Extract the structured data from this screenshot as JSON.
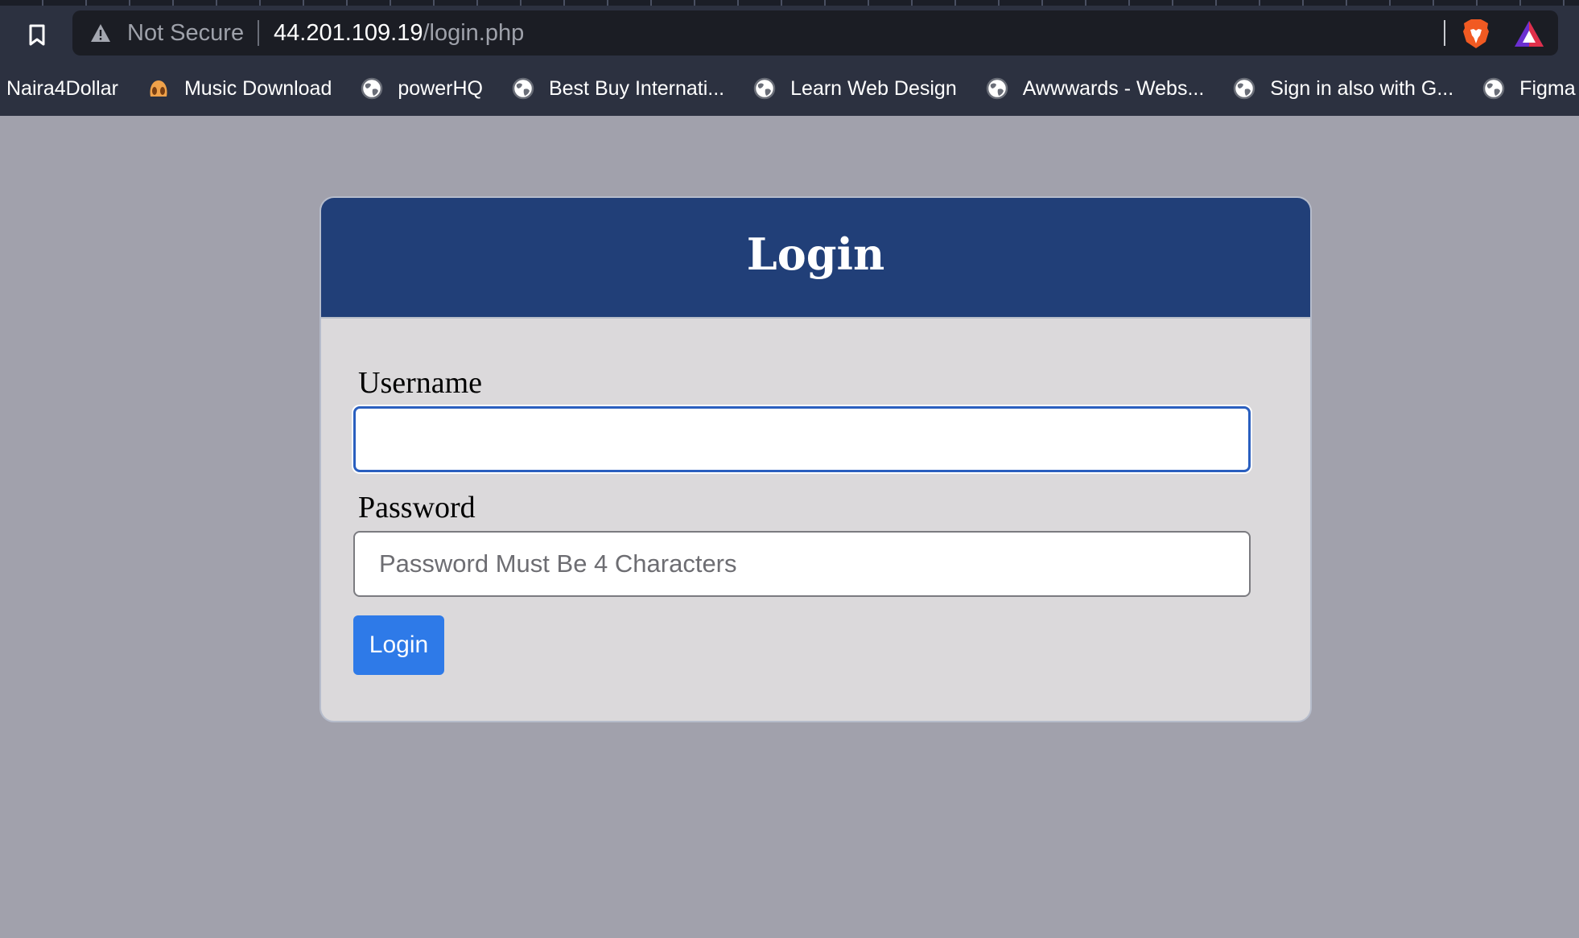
{
  "browser": {
    "security_label": "Not Secure",
    "url_host": "44.201.109.19",
    "url_path": "/login.php",
    "bookmarks": [
      {
        "label": "Naira4Dollar",
        "icon": "none"
      },
      {
        "label": "Music Download",
        "icon": "app-icon"
      },
      {
        "label": "powerHQ",
        "icon": "globe-icon"
      },
      {
        "label": "Best Buy Internati...",
        "icon": "globe-icon"
      },
      {
        "label": "Learn Web Design",
        "icon": "globe-icon"
      },
      {
        "label": "Awwwards - Webs...",
        "icon": "globe-icon"
      },
      {
        "label": "Sign in also with G...",
        "icon": "globe-icon"
      },
      {
        "label": "Figma",
        "icon": "globe-icon"
      }
    ]
  },
  "login_form": {
    "title": "Login",
    "username_label": "Username",
    "username_value": "",
    "password_label": "Password",
    "password_placeholder": "Password Must Be 4 Characters",
    "submit_label": "Login"
  },
  "colors": {
    "page_background": "#a1a1ac",
    "header_background": "#213f78",
    "card_background": "#dbd9db",
    "button_background": "#2e7ae8",
    "focus_border": "#2a5fbf"
  }
}
